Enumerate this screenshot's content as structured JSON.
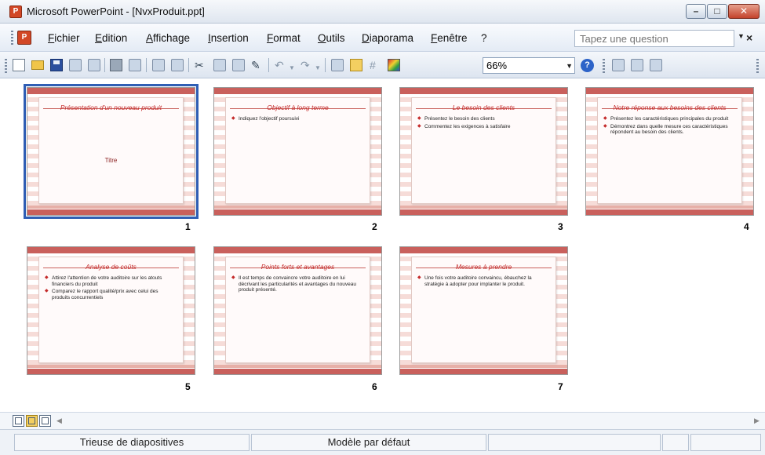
{
  "window": {
    "title": "Microsoft PowerPoint - [NvxProduit.ppt]",
    "app_icon_glyph": "P"
  },
  "menu": {
    "items": [
      "Fichier",
      "Edition",
      "Affichage",
      "Insertion",
      "Format",
      "Outils",
      "Diaporama",
      "Fenêtre",
      "?"
    ],
    "question_placeholder": "Tapez une question"
  },
  "toolbar": {
    "zoom": "66%"
  },
  "slides": [
    {
      "number": "1",
      "title": "Présentation d'un nouveau produit",
      "bullets": [],
      "center_text": "Titre",
      "selected": true
    },
    {
      "number": "2",
      "title": "Objectif à long terme",
      "bullets": [
        "Indiquez l'objectif poursuivi"
      ],
      "center_text": "",
      "selected": false
    },
    {
      "number": "3",
      "title": "Le besoin des clients",
      "bullets": [
        "Présentez le besoin des clients",
        "Commentez les exigences à satisfaire"
      ],
      "center_text": "",
      "selected": false
    },
    {
      "number": "4",
      "title": "Notre réponse aux besoins des clients",
      "bullets": [
        "Présentez les caractéristiques principales du produit",
        "Démontrez dans quelle mesure ces caractéristiques répondent au besoin des clients."
      ],
      "center_text": "",
      "selected": false
    },
    {
      "number": "5",
      "title": "Analyse de coûts",
      "bullets": [
        "Attirez l'attention de votre auditoire sur les atouts financiers du produit",
        "Comparez le rapport qualité/prix avec celui des produits concurrentiels"
      ],
      "center_text": "",
      "selected": false
    },
    {
      "number": "6",
      "title": "Points forts et avantages",
      "bullets": [
        "Il est temps de convaincre votre auditoire en lui décrivant les particularités et avantages du nouveau produit présenté."
      ],
      "center_text": "",
      "selected": false
    },
    {
      "number": "7",
      "title": "Mesures à prendre",
      "bullets": [
        "Une fois votre auditoire convaincu, ébauchez la stratégie à adopter pour implanter le produit."
      ],
      "center_text": "",
      "selected": false
    }
  ],
  "status": {
    "view": "Trieuse de diapositives",
    "template": "Modèle par défaut"
  },
  "colors": {
    "accent": "#c9605c",
    "selection": "#2f5eb4"
  }
}
